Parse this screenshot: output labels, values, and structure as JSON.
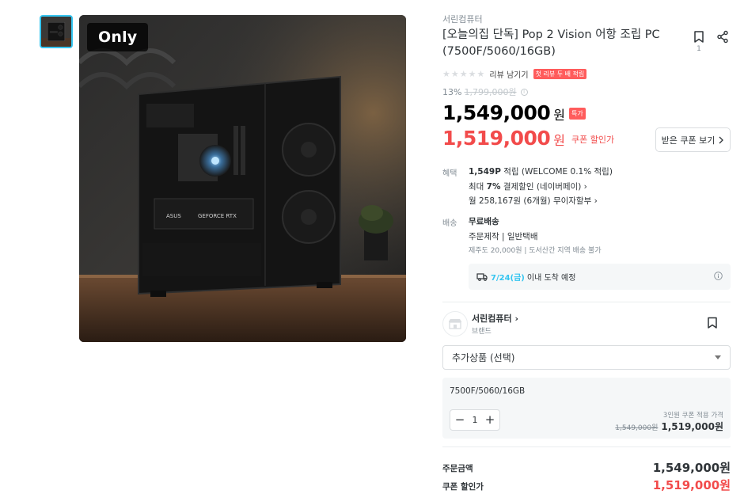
{
  "gallery": {
    "badge": "Only",
    "thumbnail_count": 1
  },
  "product": {
    "brand": "서린컴퓨터",
    "title": "[오늘의집 단독] Pop 2 Vision 어항 조립 PC (7500F/5060/16GB)",
    "scrap_count": "1",
    "review_link": "리뷰 남기기",
    "review_badge": "첫 리뷰 두 배 적립",
    "discount_rate": "13%",
    "original_price": "1,799,000원",
    "price": "1,549,000",
    "won": "원",
    "special_badge": "특가",
    "coupon_price": "1,519,000",
    "coupon_label": "쿠폰 할인가",
    "coupon_button": "받은 쿠폰 보기"
  },
  "benefit": {
    "label": "혜택",
    "point_value": "1,549P",
    "point_text": "적립 (WELCOME 0.1% 적립)",
    "card_prefix": "최대",
    "card_rate": "7%",
    "card_text": "결제할인 (네이버페이)",
    "installment": "월 258,167원 (6개월) 무이자할부"
  },
  "shipping": {
    "label": "배송",
    "type": "무료배송",
    "method": "주문제작 | 일반택배",
    "extra": "제주도 20,000원 | 도서산간 지역 배송 불가",
    "arrival_date": "7/24(금)",
    "arrival_text": "이내 도착 예정"
  },
  "seller": {
    "name": "서린컴퓨터",
    "sub": "브랜드"
  },
  "options": {
    "select_placeholder": "추가상품 (선택)",
    "selected_name": "7500F/5060/16GB",
    "quantity": "1",
    "coupon_note": "3인원 쿠폰 적용 가격",
    "orig_price": "1,549,000원",
    "final_price": "1,519,000원"
  },
  "totals": {
    "order_label": "주문금액",
    "order_value": "1,549,000원",
    "coupon_label": "쿠폰 할인가",
    "coupon_value": "1,519,000원"
  },
  "colors": {
    "accent": "#35c5f0",
    "sale_red": "#f24b4b",
    "text": "#2f3438",
    "muted": "#828c94"
  }
}
